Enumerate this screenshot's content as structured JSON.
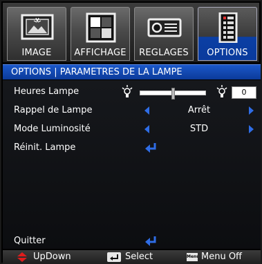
{
  "tabs": [
    {
      "label": "IMAGE",
      "icon": "picture-frame-icon",
      "active": false
    },
    {
      "label": "AFFICHAGE",
      "icon": "display-icon",
      "active": false
    },
    {
      "label": "REGLAGES",
      "icon": "projector-icon",
      "active": false
    },
    {
      "label": "OPTIONS",
      "icon": "options-list-icon",
      "active": true
    }
  ],
  "title": "OPTIONS | PARAMETRES DE LA LAMPE",
  "rows": {
    "lamp_hours": {
      "label": "Heures Lampe",
      "value": "0",
      "slider_fraction": 0.5
    },
    "lamp_reminder": {
      "label": "Rappel de Lampe",
      "value": "Arrêt"
    },
    "brightness_mode": {
      "label": "Mode Luminosité",
      "value": "STD"
    },
    "lamp_reset": {
      "label": "Réinit. Lampe"
    },
    "quit": {
      "label": "Quitter"
    }
  },
  "footer": {
    "updown": "UpDown",
    "select": "Select",
    "menu_key": "Menu",
    "menu_off": "Menu Off"
  },
  "colors": {
    "accent_blue": "#1b58c9",
    "arrow_blue": "#2f6de6",
    "updown_red": "#e01c1c"
  }
}
